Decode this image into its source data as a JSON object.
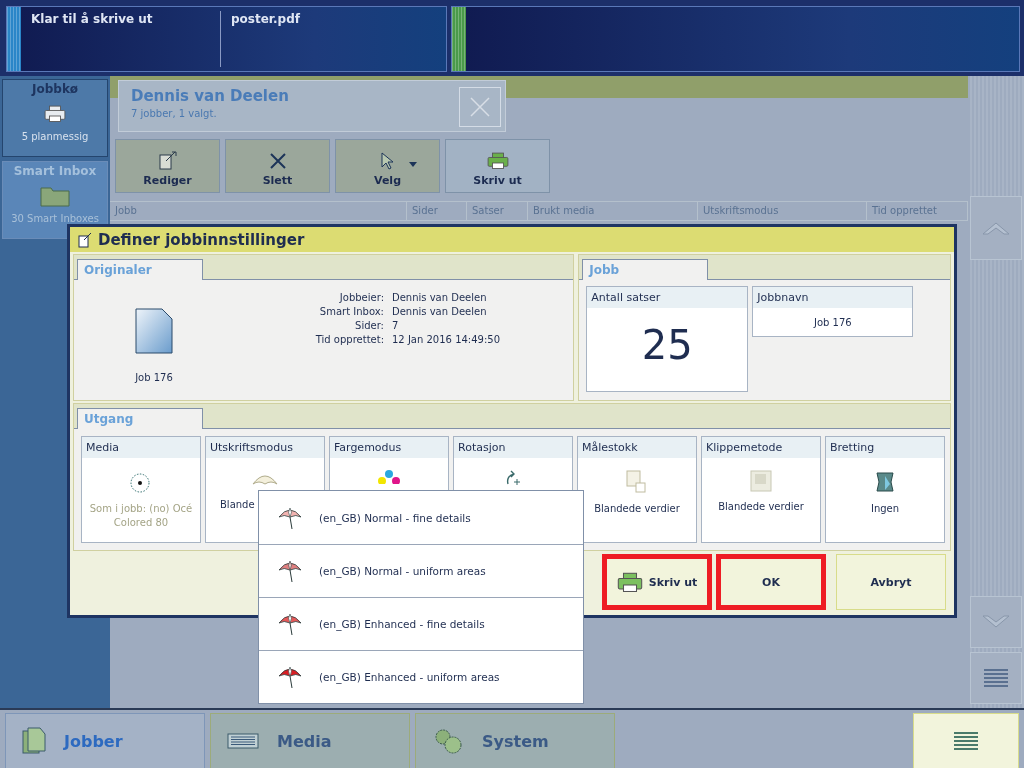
{
  "status_bar": {
    "state": "Klar til å skrive ut",
    "file": "poster.pdf"
  },
  "sidebar": {
    "items": [
      {
        "kind": "queue",
        "title": "Jobbkø",
        "subtitle": "5 planmessig",
        "selected": true
      },
      {
        "kind": "inbox",
        "title": "Smart Inbox",
        "subtitle": "30 Smart Inboxes",
        "selected": false
      }
    ]
  },
  "inbox": {
    "title": "Dennis van Deelen",
    "subtitle": "7 jobber, 1 valgt."
  },
  "toolbar": [
    {
      "kind": "edit",
      "label": "Rediger"
    },
    {
      "kind": "delete",
      "label": "Slett"
    },
    {
      "kind": "select",
      "label": "Velg"
    },
    {
      "kind": "print",
      "label": "Skriv ut"
    }
  ],
  "table": {
    "columns": [
      "Jobb",
      "Sider",
      "Satser",
      "Brukt media",
      "Utskriftsmodus",
      "Tid opprettet"
    ]
  },
  "dialog": {
    "title": "Definer jobbinnstillinger",
    "originals": {
      "tab": "Originaler",
      "file_name": "Job 176",
      "details": [
        {
          "label": "Jobbeier:",
          "value": "Dennis van Deelen"
        },
        {
          "label": "Smart Inbox:",
          "value": "Dennis van Deelen"
        },
        {
          "label": "Sider:",
          "value": "7"
        },
        {
          "label": "Tid opprettet:",
          "value": "12 Jan 2016 14:49:50"
        }
      ]
    },
    "job": {
      "tab": "Jobb",
      "copies": {
        "label": "Antall satser",
        "value": "25"
      },
      "name": {
        "label": "Jobbnavn",
        "value": "Job 176"
      }
    },
    "output": {
      "tab": "Utgang",
      "settings": [
        {
          "kind": "media",
          "label": "Media",
          "value": "Som i jobb:  (no) Océ Colored 80",
          "muted": true
        },
        {
          "kind": "print_mode",
          "label": "Utskriftsmodus",
          "value": "Blande",
          "muted": false
        },
        {
          "kind": "color_mode",
          "label": "Fargemodus"
        },
        {
          "kind": "rotation",
          "label": "Rotasjon"
        },
        {
          "kind": "scale",
          "label": "Målestokk",
          "value": "Blandede verdier",
          "muted": false
        },
        {
          "kind": "cut",
          "label": "Klippemetode",
          "value": "Blandede verdier",
          "muted": false
        },
        {
          "kind": "fold",
          "label": "Bretting",
          "value": "Ingen",
          "muted": false
        }
      ]
    },
    "buttons": [
      {
        "kind": "print",
        "label": "Skriv ut",
        "highlighted": true
      },
      {
        "kind": "ok",
        "label": "OK",
        "highlighted": true
      },
      {
        "kind": "cancel",
        "label": "Avbryt",
        "highlighted": false
      }
    ]
  },
  "dropdown": {
    "items": [
      {
        "kind": "light",
        "label": "(en_GB) Normal - fine details"
      },
      {
        "kind": "medium",
        "label": "(en_GB) Normal - uniform areas"
      },
      {
        "kind": "strong",
        "label": "(en_GB) Enhanced - fine details"
      },
      {
        "kind": "full",
        "label": "(en_GB) Enhanced - uniform areas"
      }
    ]
  },
  "bottom_nav": {
    "tabs": [
      {
        "kind": "jobs",
        "label": "Jobber",
        "selected": true
      },
      {
        "kind": "media",
        "label": "Media",
        "selected": false
      },
      {
        "kind": "system",
        "label": "System",
        "selected": false
      }
    ]
  }
}
